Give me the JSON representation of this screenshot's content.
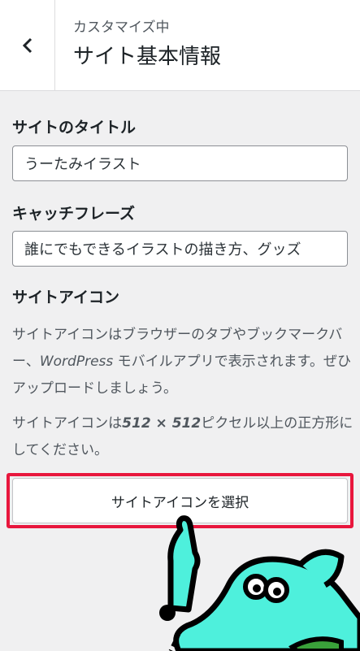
{
  "header": {
    "back_icon": "chevron-left-icon",
    "subtitle": "カスタマイズ中",
    "title": "サイト基本情報"
  },
  "site_title": {
    "label": "サイトのタイトル",
    "value": "うーたみイラスト"
  },
  "tagline": {
    "label": "キャッチフレーズ",
    "value": "誰にでもできるイラストの描き方、グッズ"
  },
  "site_icon": {
    "label": "サイトアイコン",
    "description_1a": "サイトアイコンはブラウザーのタブやブックマークバー、",
    "description_1b": "WordPress",
    "description_1c": " モバイルアプリで表示されます。ぜひアップロードしましょう。",
    "description_2a": "サイトアイコンは",
    "description_2b": "512 × 512",
    "description_2c": "ピクセル以上の正方形にしてください。",
    "button_label": "サイトアイコンを選択"
  },
  "colors": {
    "highlight": "#e8173d",
    "mascot": "#4ef0dc",
    "background": "#f0f0f1"
  }
}
